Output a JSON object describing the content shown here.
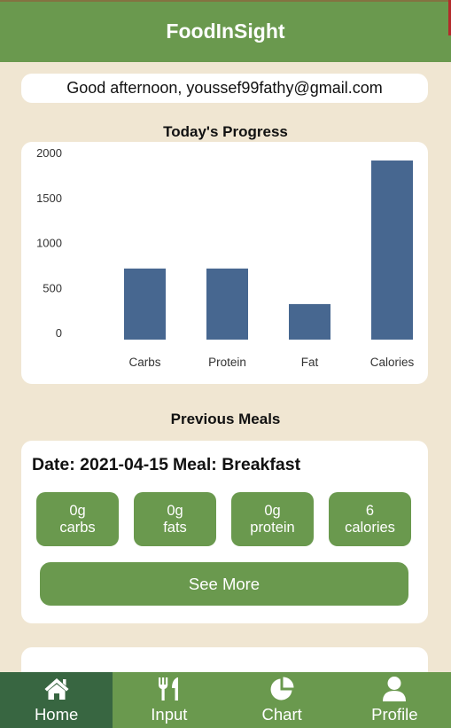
{
  "app": {
    "title": "FoodInSight"
  },
  "greeting": "Good afternoon, youssef99fathy@gmail.com",
  "progress": {
    "title": "Today's Progress"
  },
  "chart_data": {
    "type": "bar",
    "categories": [
      "Carbs",
      "Protein",
      "Fat",
      "Calories"
    ],
    "values": [
      790,
      790,
      395,
      1990
    ],
    "ylim": [
      0,
      2000
    ],
    "yticks": [
      0,
      500,
      1000,
      1500,
      2000
    ],
    "bar_color": "#476790",
    "grid": false
  },
  "meals": {
    "title": "Previous Meals",
    "items": [
      {
        "date_label": "Date: 2021-04-15",
        "meal_label": "Meal: Breakfast",
        "carbs": {
          "value": "0g",
          "label": "carbs"
        },
        "fats": {
          "value": "0g",
          "label": "fats"
        },
        "protein": {
          "value": "0g",
          "label": "protein"
        },
        "calories": {
          "value": "6",
          "label": "calories"
        },
        "see_more_label": "See More"
      }
    ]
  },
  "tabbar": {
    "items": [
      {
        "label": "Home",
        "icon": "home-icon",
        "active": true
      },
      {
        "label": "Input",
        "icon": "fork-knife-icon",
        "active": false
      },
      {
        "label": "Chart",
        "icon": "pie-chart-icon",
        "active": false
      },
      {
        "label": "Profile",
        "icon": "user-icon",
        "active": false
      }
    ]
  },
  "colors": {
    "primary": "#6a994e",
    "primary_dark": "#386641",
    "background": "#f0e6d2",
    "bar": "#476790"
  }
}
